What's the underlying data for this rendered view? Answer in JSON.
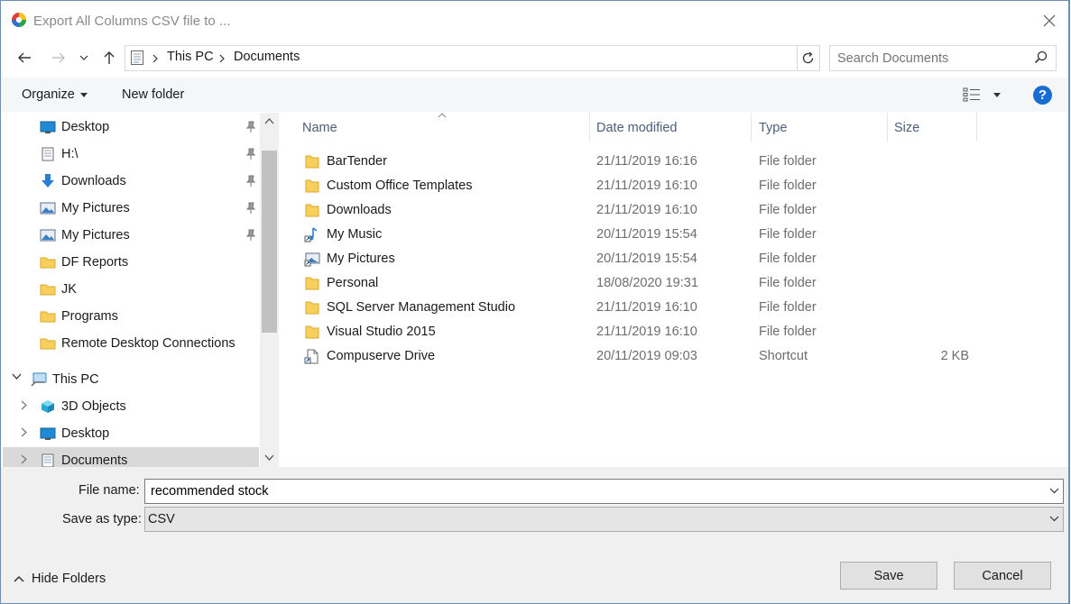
{
  "window": {
    "title": "Export All Columns CSV file to ..."
  },
  "address": {
    "segments": [
      "This PC",
      "Documents"
    ]
  },
  "search": {
    "placeholder": "Search Documents"
  },
  "toolbar": {
    "organize_label": "Organize",
    "new_folder_label": "New folder",
    "help_label": "?"
  },
  "nav_pane": {
    "items": [
      {
        "label": "Desktop",
        "icon": "desktop-icon",
        "pinned": true
      },
      {
        "label": "H:\\",
        "icon": "drive-icon",
        "pinned": true
      },
      {
        "label": "Downloads",
        "icon": "download-arrow-icon",
        "pinned": true
      },
      {
        "label": "My Pictures",
        "icon": "pictures-icon",
        "pinned": true
      },
      {
        "label": "My Pictures",
        "icon": "pictures-icon",
        "pinned": true
      },
      {
        "label": "DF Reports",
        "icon": "folder-icon",
        "pinned": false
      },
      {
        "label": "JK",
        "icon": "folder-icon",
        "pinned": false
      },
      {
        "label": "Programs",
        "icon": "folder-icon",
        "pinned": false
      },
      {
        "label": "Remote Desktop Connections",
        "icon": "folder-icon",
        "pinned": false
      },
      {
        "label": "This PC",
        "icon": "this-pc-icon",
        "expanded": true
      },
      {
        "label": "3D Objects",
        "icon": "3d-objects-icon",
        "collapsed": true
      },
      {
        "label": "Desktop",
        "icon": "desktop-icon",
        "collapsed": true
      },
      {
        "label": "Documents",
        "icon": "documents-icon",
        "collapsed": true,
        "selected": true
      }
    ]
  },
  "columns": {
    "name": "Name",
    "date_modified": "Date modified",
    "type": "Type",
    "size": "Size"
  },
  "files": [
    {
      "name": "BarTender",
      "date": "21/11/2019 16:16",
      "type": "File folder",
      "size": "",
      "icon": "folder-icon"
    },
    {
      "name": "Custom Office Templates",
      "date": "21/11/2019 16:10",
      "type": "File folder",
      "size": "",
      "icon": "folder-icon"
    },
    {
      "name": "Downloads",
      "date": "21/11/2019 16:10",
      "type": "File folder",
      "size": "",
      "icon": "folder-icon"
    },
    {
      "name": "My Music",
      "date": "20/11/2019 15:54",
      "type": "File folder",
      "size": "",
      "icon": "music-shortcut-icon"
    },
    {
      "name": "My Pictures",
      "date": "20/11/2019 15:54",
      "type": "File folder",
      "size": "",
      "icon": "pictures-shortcut-icon"
    },
    {
      "name": "Personal",
      "date": "18/08/2020 19:31",
      "type": "File folder",
      "size": "",
      "icon": "folder-icon"
    },
    {
      "name": "SQL Server Management Studio",
      "date": "21/11/2019 16:10",
      "type": "File folder",
      "size": "",
      "icon": "folder-icon"
    },
    {
      "name": "Visual Studio 2015",
      "date": "21/11/2019 16:10",
      "type": "File folder",
      "size": "",
      "icon": "folder-icon"
    },
    {
      "name": "Compuserve Drive",
      "date": "20/11/2019 09:03",
      "type": "Shortcut",
      "size": "2 KB",
      "icon": "shortcut-icon"
    }
  ],
  "form": {
    "file_name_label": "File name:",
    "file_name_value": "recommended stock",
    "save_type_label": "Save as type:",
    "save_type_value": "CSV"
  },
  "footer": {
    "hide_folders_label": "Hide Folders",
    "save_label": "Save",
    "cancel_label": "Cancel"
  },
  "colors": {
    "folder": "#f8cf5b",
    "selected_nav": "#d9d9d9",
    "accent": "#1a6dd0"
  }
}
